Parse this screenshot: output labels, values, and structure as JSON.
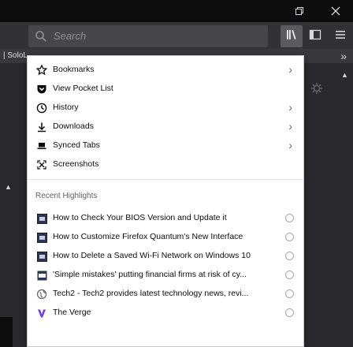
{
  "window": {
    "restore_icon": "restore-icon",
    "close_icon": "close-icon"
  },
  "navbar": {
    "search_placeholder": "Search",
    "library_icon": "library-icon",
    "sidebar_icon": "sidebar-icon",
    "menu_icon": "hamburger-icon"
  },
  "bookmarks_bar": {
    "first_item": "| SoloL"
  },
  "library_panel": {
    "items": [
      {
        "label": "Bookmarks",
        "icon": "star-icon",
        "has_arrow": true
      },
      {
        "label": "View Pocket List",
        "icon": "pocket-icon",
        "has_arrow": false
      },
      {
        "label": "History",
        "icon": "clock-icon",
        "has_arrow": true
      },
      {
        "label": "Downloads",
        "icon": "download-icon",
        "has_arrow": true
      },
      {
        "label": "Synced Tabs",
        "icon": "synced-tabs-icon",
        "has_arrow": true
      },
      {
        "label": "Screenshots",
        "icon": "screenshot-icon",
        "has_arrow": false
      }
    ],
    "recent_heading": "Recent Highlights",
    "highlights": [
      {
        "label": "How to Check Your BIOS Version and Update it",
        "icon": "site-favicon"
      },
      {
        "label": "How to Customize Firefox Quantum's New Interface",
        "icon": "site-favicon"
      },
      {
        "label": "How to Delete a Saved Wi-Fi Network on Windows 10",
        "icon": "site-favicon"
      },
      {
        "label": "'Simple mistakes' putting financial firms at risk of cy...",
        "icon": "site-favicon"
      },
      {
        "label": "Tech2 - Tech2 provides latest technology news, revi...",
        "icon": "globe-icon"
      },
      {
        "label": "The Verge",
        "icon": "verge-icon"
      }
    ]
  },
  "colors": {
    "panel_bg": "#ffffff",
    "chrome_bg": "#323234",
    "text": "#0c0c0d"
  }
}
